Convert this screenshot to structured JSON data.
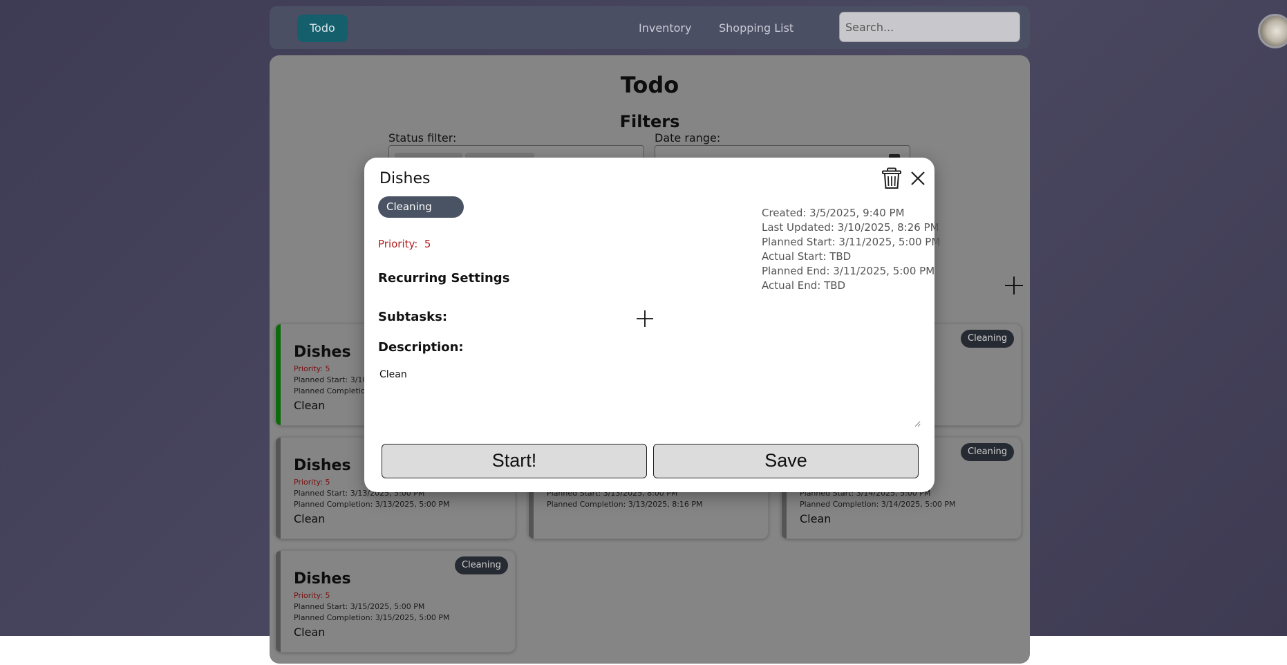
{
  "nav": {
    "tabs": [
      {
        "label": "Todo",
        "active": true
      },
      {
        "label": "Inventory",
        "active": false
      },
      {
        "label": "Shopping List",
        "active": false
      }
    ],
    "search_placeholder": "Search..."
  },
  "page": {
    "title": "Todo",
    "filters_title": "Filters",
    "status_filter_label": "Status filter:",
    "date_range_label": "Date range:"
  },
  "cards": [
    {
      "title": "Dishes",
      "priority": "Priority: 5",
      "planned_start": "Planned Start: 3/10,",
      "planned_completion": "Planned Completio",
      "description": "Clean",
      "status_color": "#0b6b0b"
    },
    {
      "title": "",
      "priority": "",
      "planned_start": "",
      "planned_completion": "PM",
      "description": "",
      "badge": "Cleaning"
    },
    {
      "title": "Dishes",
      "priority": "Priority: 5",
      "planned_start": "Planned Start: 3/13/2025, 5:00 PM",
      "planned_completion": "Planned Completion: 3/13/2025, 5:00 PM",
      "description": "Clean"
    },
    {
      "title": "",
      "priority": "",
      "planned_start": "Planned Start: 3/13/2025, 8:00 PM",
      "planned_completion": "Planned Completion: 3/13/2025, 8:16 PM",
      "description": ""
    },
    {
      "title": "",
      "priority": "",
      "planned_start": "Planned Start: 3/14/2025, 5:00 PM",
      "planned_completion": "Planned Completion: 3/14/2025, 5:00 PM",
      "description": "Clean",
      "badge": "Cleaning"
    },
    {
      "title": "Dishes",
      "priority": "Priority: 5",
      "planned_start": "Planned Start: 3/15/2025, 5:00 PM",
      "planned_completion": "Planned Completion: 3/15/2025, 5:00 PM",
      "description": "Clean",
      "badge": "Cleaning"
    }
  ],
  "modal": {
    "title": "Dishes",
    "category": "Cleaning",
    "priority_label": "Priority:",
    "priority_value": "5",
    "meta": {
      "created": "Created: 3/5/2025, 9:40 PM",
      "last_updated": "Last Updated: 3/10/2025, 8:26 PM",
      "planned_start": "Planned Start: 3/11/2025, 5:00 PM",
      "actual_start": "Actual Start: TBD",
      "planned_end": "Planned End: 3/11/2025, 5:00 PM",
      "actual_end": "Actual End: TBD"
    },
    "recurring_title": "Recurring Settings",
    "subtasks_title": "Subtasks:",
    "description_title": "Description:",
    "description_value": "Clean",
    "start_button": "Start!",
    "save_button": "Save"
  },
  "icons": {
    "trash": "trash-icon",
    "close": "close-icon",
    "plus": "plus-icon",
    "calendar": "calendar-icon"
  },
  "colors": {
    "active_tab": "#155e6b",
    "badge": "#4a5363",
    "priority": "#b32020",
    "in_progress_stripe": "#0b6b0b"
  }
}
